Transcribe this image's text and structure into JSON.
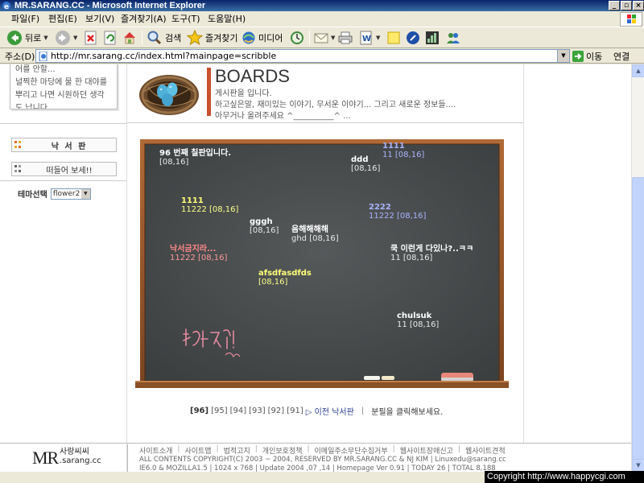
{
  "window": {
    "title": "MR.SARANG.CC - Microsoft Internet Explorer"
  },
  "menu": [
    "파일(F)",
    "편집(E)",
    "보기(V)",
    "즐겨찾기(A)",
    "도구(T)",
    "도움말(H)"
  ],
  "toolbar": {
    "back": "뒤로",
    "search": "검색",
    "favorites": "즐겨찾기",
    "media": "미디어"
  },
  "addressbar": {
    "label": "주소(D)",
    "url": "http://mr.sarang.cc/index.html?mainpage=scribble",
    "go": "이동",
    "links": "연결"
  },
  "sidebar": {
    "note_lines": [
      "어를 안할...",
      "널찍한 마당에 물 한 대야를",
      "뿌리고 나면 시원하던 생각",
      "도 납니다"
    ],
    "btn_scribble": "낙 서 판",
    "btn_chat": "떠들어 보세!!",
    "theme_label": "테마선택",
    "theme_value": "flower2"
  },
  "header": {
    "title": "BOARDS",
    "desc_line1": "게시판을 입니다.",
    "desc_line2": "하고싶은말, 재미있는 이야기, 무서운 이야기... 그리고 새로운 정보들....",
    "desc_line3": "아무거나 올려주세요 ^__________^  ..."
  },
  "scribbles": [
    {
      "title": "96 번째 칠판입니다.",
      "sub": "[08,16]",
      "color": "white"
    },
    {
      "title": "1111",
      "sub": "11 [08,16]",
      "color": "blue"
    },
    {
      "title": "ddd",
      "sub": "[08,16]",
      "color": "white"
    },
    {
      "title": "1111",
      "sub": "11222 [08,16]",
      "color": "yellow"
    },
    {
      "title": "2222",
      "sub": "11222 [08,16]",
      "color": "blue"
    },
    {
      "title": "gggh",
      "sub": "[08,16]",
      "color": "white"
    },
    {
      "title": "음해해해해",
      "sub": "ghd [08,16]",
      "color": "white"
    },
    {
      "title": "낙서금지라...",
      "sub": "11222 [08,16]",
      "color": "red"
    },
    {
      "title": "쿡 이런게 다있나?..ㅋㅋ",
      "sub": "11 [08,16]",
      "color": "white"
    },
    {
      "title": "afsdfasdfds",
      "sub": "[08,16]",
      "color": "yellow"
    },
    {
      "title": "chulsuk",
      "sub": "11 [08,16]",
      "color": "white"
    }
  ],
  "board_signature": "낙서금지!",
  "pager": {
    "current": "[96]",
    "pages": [
      "[95]",
      "[94]",
      "[93]",
      "[92]",
      "[91]"
    ],
    "prev": "▷ 이전 낙서판",
    "divider": "|",
    "hint": "분필을 클릭해보세요."
  },
  "footer": {
    "logo_mr": "MR",
    "logo_kr": "사랑씨씨",
    "logo_domain": ".sarang.cc",
    "links": [
      "사이트소개",
      "사이트맵",
      "법적고지",
      "개인보호정책",
      "이메일주소무단수집거부",
      "웹사이트장애신고",
      "웹사이트견적"
    ],
    "copy_line1": "ALL CONTENTS COPYRIGHT(C) 2003 ~ 2004, RESERVED BY MR.SARANG.CC & NJ KIM  |  Linuxedu@sarang.cc",
    "copy_line2": "IE6.0 & MOZILLA1.5  |  1024 x 768  |  Update 2004 ,07 ,14  |  Homepage Ver 0.91  |  TODAY 26  |  TOTAL 8,188"
  },
  "watermark": "Copyright  http://www.happycgi.com"
}
